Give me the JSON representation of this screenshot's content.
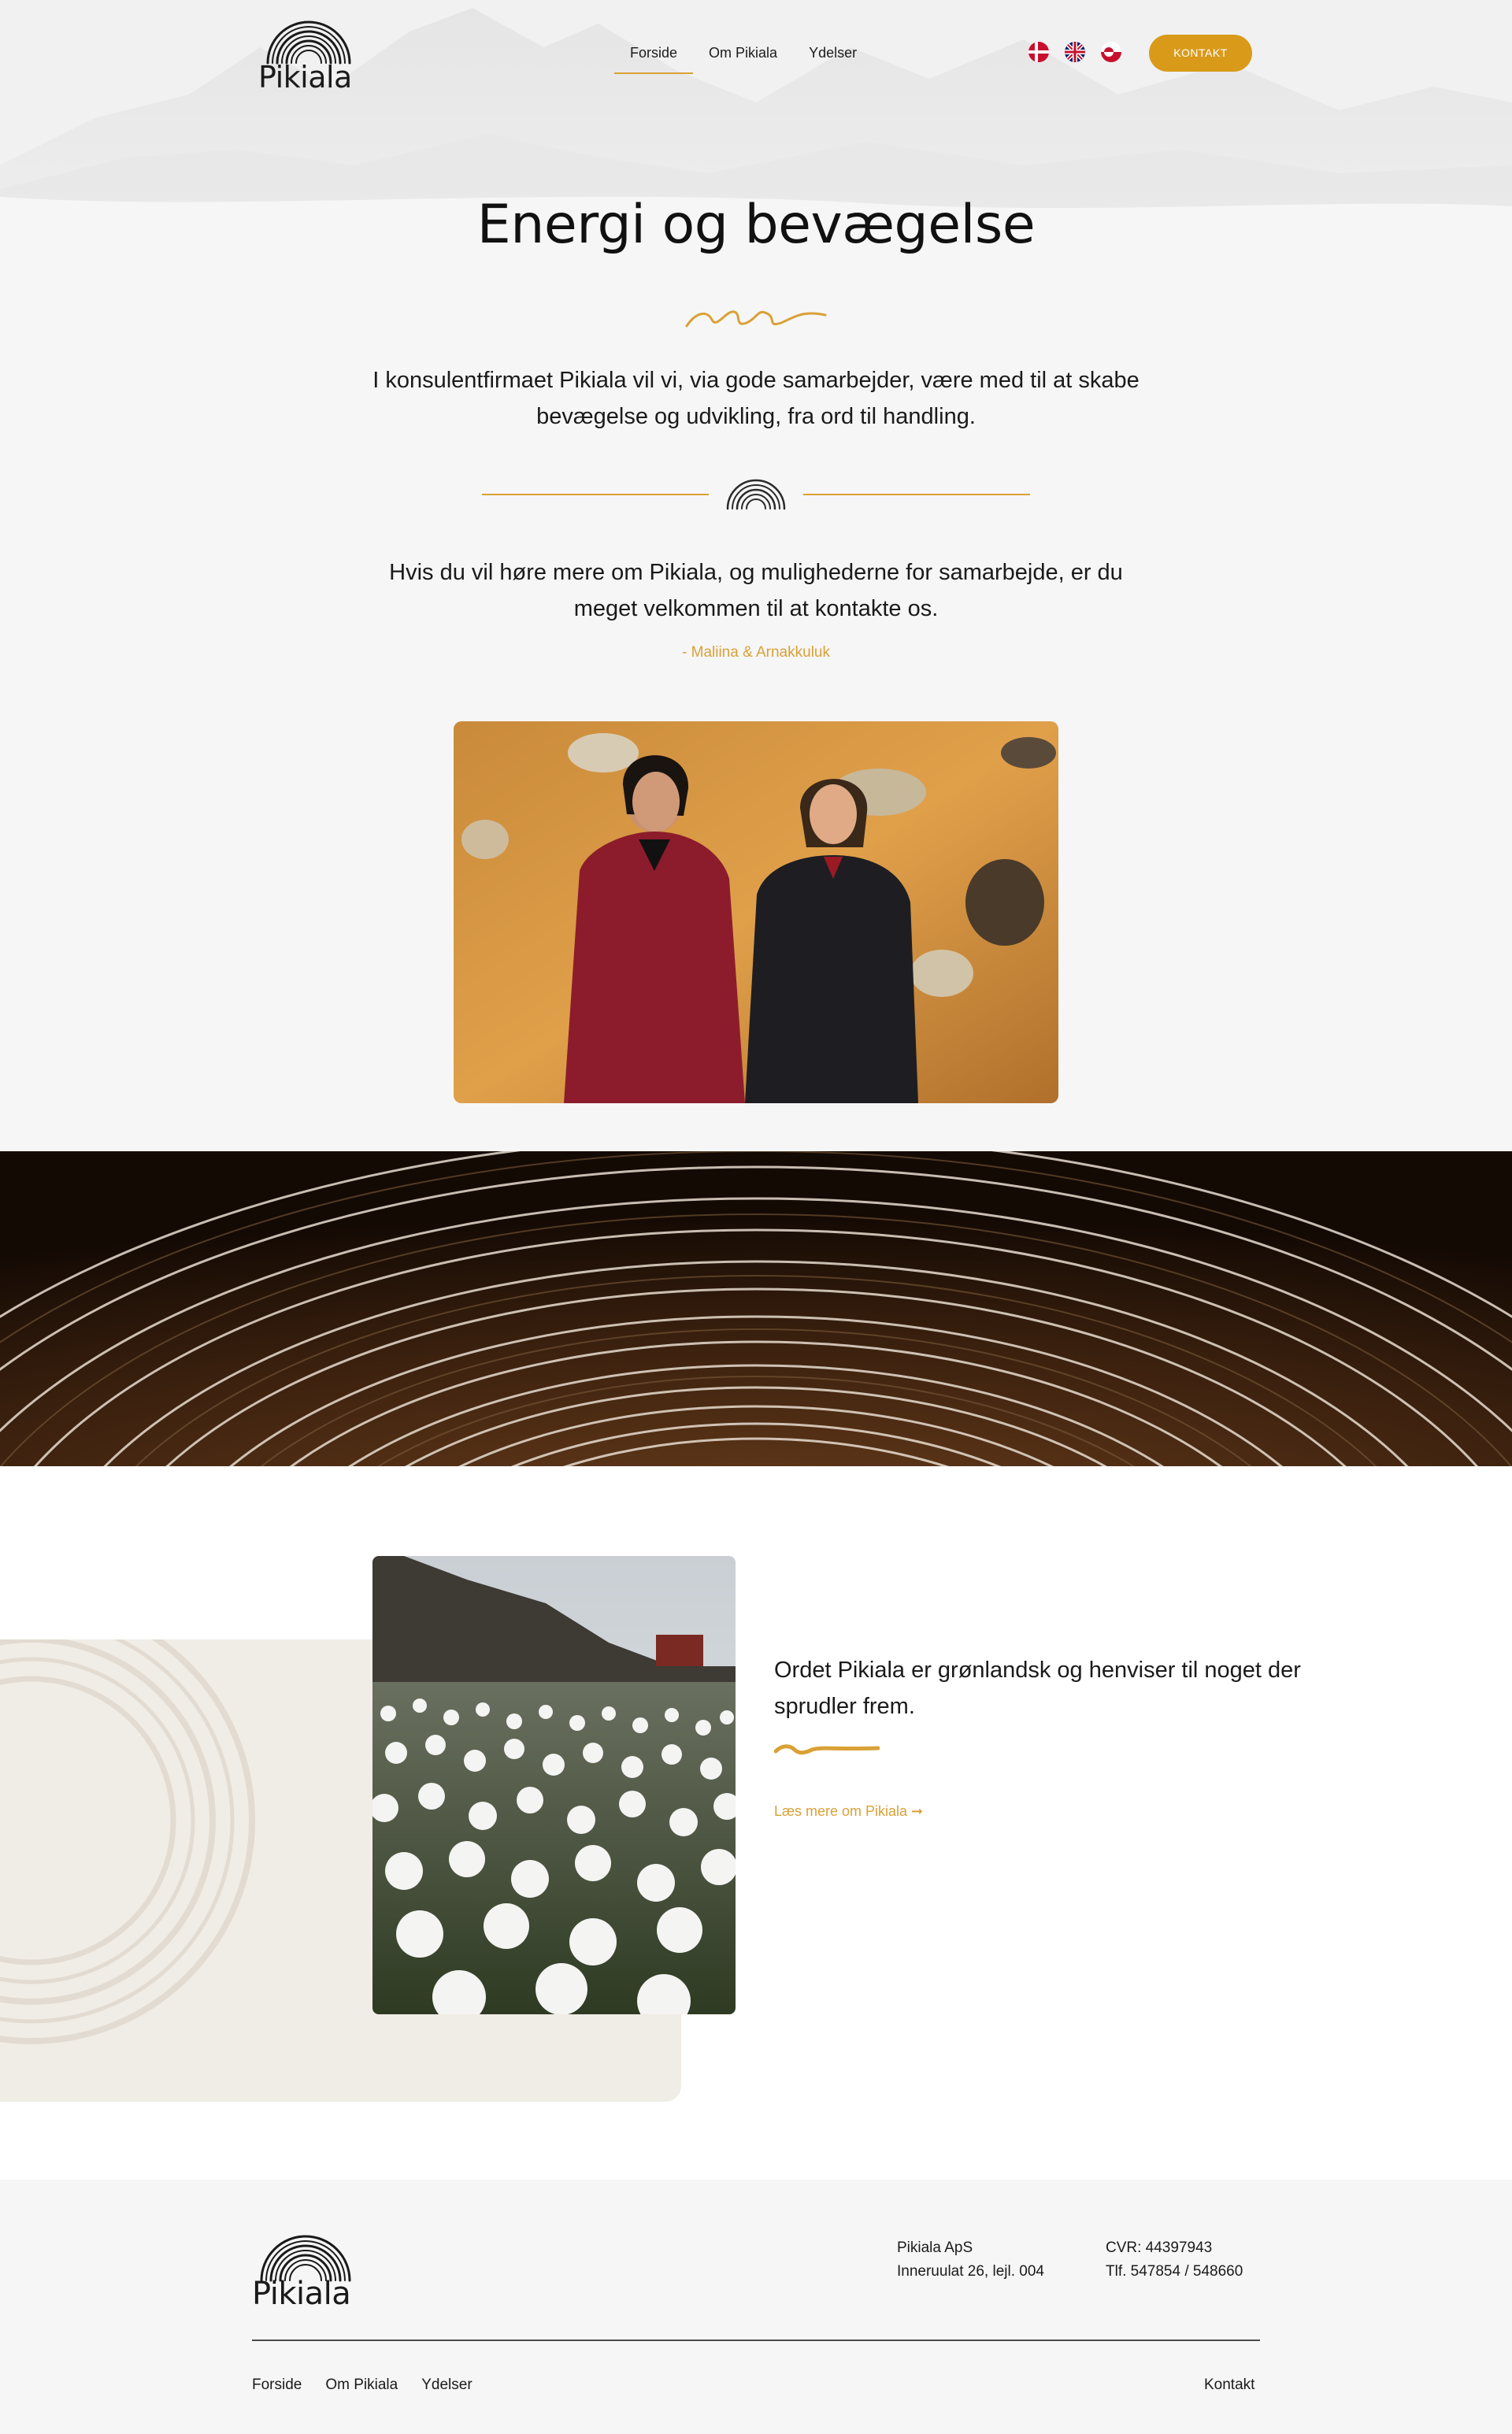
{
  "header": {
    "logo_text": "Pikiala",
    "nav": [
      {
        "label": "Forside",
        "active": true
      },
      {
        "label": "Om Pikiala",
        "active": false
      },
      {
        "label": "Ydelser",
        "active": false
      }
    ],
    "languages": [
      "danish-flag-icon",
      "uk-flag-icon",
      "greenland-flag-icon"
    ],
    "cta_label": "KONTAKT"
  },
  "hero": {
    "title": "Energi og bevægelse",
    "intro": "I konsulentfirmaet Pikiala vil vi, via gode samarbejder, være med til at skabe bevægelse og udvikling, fra ord til handling.",
    "contact_text": "Hvis du vil høre mere om Pikiala, og mulighederne for samarbejde, er du meget velkommen til at kontakte os.",
    "signature": "- Maliina & Arnakkuluk"
  },
  "about": {
    "text": "Ordet Pikiala er grønlandsk og henviser til noget der sprudler frem.",
    "link_label": "Læs mere om Pikiala ➞"
  },
  "footer": {
    "logo_text": "Pikiala",
    "company": "Pikiala ApS",
    "address": "Inneruulat 26, lejl. 004",
    "cvr": "CVR: 44397943",
    "phone": "Tlf. 547854 / 548660",
    "nav": [
      "Forside",
      "Om Pikiala",
      "Ydelser"
    ],
    "contact_link": "Kontakt"
  },
  "colors": {
    "accent": "#d99a1a",
    "background": "#f6f6f6",
    "beige": "#f0ece6"
  }
}
